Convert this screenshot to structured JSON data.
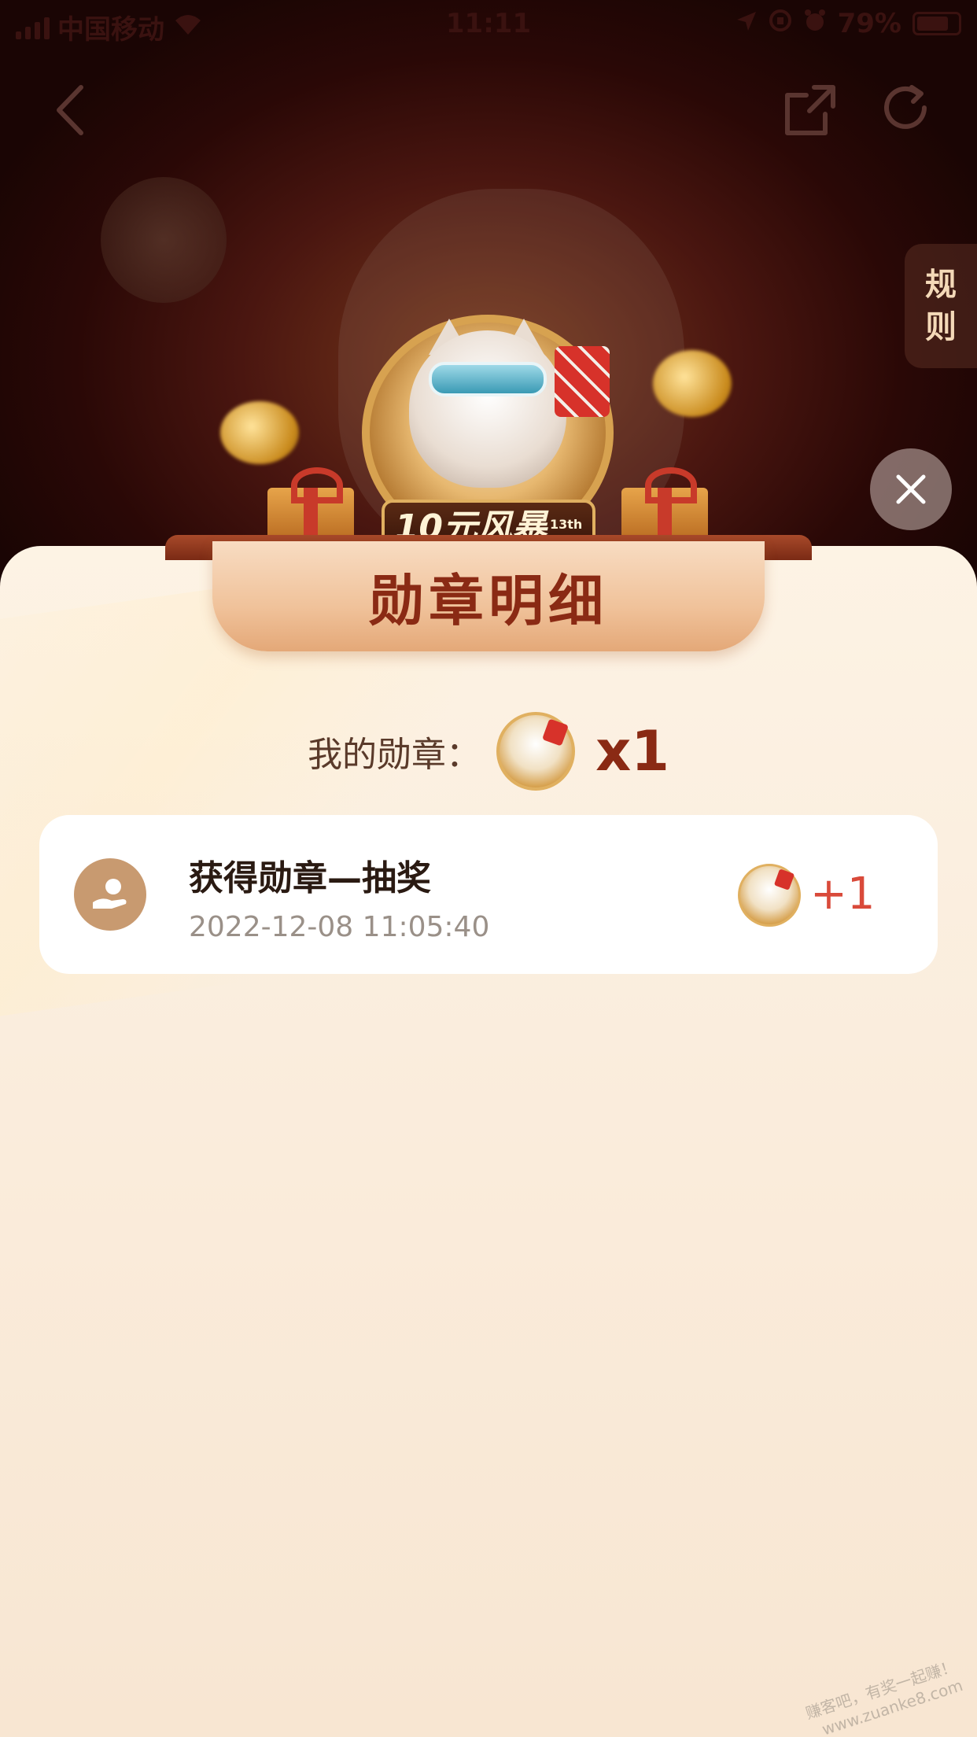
{
  "status_bar": {
    "carrier": "中国移动",
    "time": "11:11",
    "battery": "79%"
  },
  "nav": {
    "back_icon": "chevron-left-icon",
    "share_icon": "share-icon",
    "refresh_icon": "refresh-icon"
  },
  "rules_tab": {
    "label_line1": "规",
    "label_line2": "则"
  },
  "hero": {
    "banner_text": "10元风暴",
    "banner_sup": "13th"
  },
  "sheet": {
    "title": "勋章明细",
    "my_medal_label": "我的勋章：",
    "my_medal_count": "x1",
    "records": [
      {
        "title": "获得勋章—抽奖",
        "time": "2022-12-08 11:05:40",
        "delta": "+1",
        "icon": "lottery-hand-icon"
      }
    ]
  },
  "watermark": {
    "line1": "赚客吧，有奖一起赚！",
    "line2": "www.zuanke8.com"
  },
  "colors": {
    "title_red": "#8a2a14",
    "delta_red": "#d94a3a",
    "sheet_bg": "#f8e6d2",
    "record_icon_bg": "#c89a70"
  }
}
